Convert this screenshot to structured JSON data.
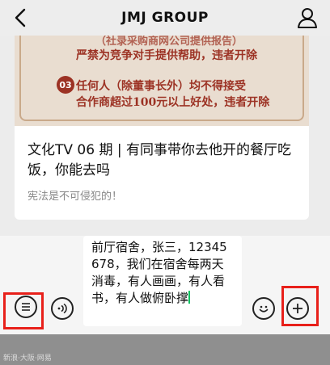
{
  "header": {
    "title": "JMJ GROUP",
    "back_icon": "chevron-left-icon",
    "profile_icon": "person-icon"
  },
  "article_card": {
    "banner_lines": [
      "（社录采购商网公司提供报告）",
      "严禁为竞争对手提供帮助，违者开除",
      "任何人（除董事长外）均不得接受",
      "合作商超过100元以上好处，违者开除"
    ],
    "banner_number": "03",
    "title": "文化TV 06 期 | 有同事带你去他开的餐厅吃饭，你能去吗",
    "description": "宪法是不可侵犯的！",
    "colors": {
      "banner_bg": "#e9ddd0",
      "banner_text": "#9c3224"
    }
  },
  "input_bar": {
    "text": "前厅宿舍，张三，12345678，我们在宿舍每两天消毒，有人画画，有人看书，有人做俯卧撑",
    "menu_icon": "list-menu-icon",
    "voice_icon": "voice-icon",
    "emoji_icon": "smiley-icon",
    "plus_icon": "plus-icon",
    "highlight_color": "#e8201a"
  },
  "watermark": "新浪·大阪·网易"
}
